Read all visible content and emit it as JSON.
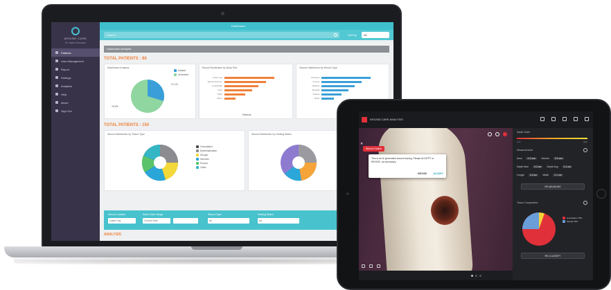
{
  "laptop": {
    "app_title": "Dashboard",
    "logo_text": "WOUND CARE",
    "logo_sub": "Dr. Name Surname",
    "nav_items": [
      {
        "label": "Patients"
      },
      {
        "label": "User Management"
      },
      {
        "label": "Report"
      },
      {
        "label": "Settings"
      },
      {
        "label": "Analytics"
      },
      {
        "label": "Help"
      },
      {
        "label": "About"
      },
      {
        "label": "Sign Out"
      }
    ],
    "search_placeholder": "Search",
    "sort_label": "Sort by",
    "sort_value": "All",
    "section_header": "Dashboard Analysis",
    "total_patients_1": "TOTAL PATIENTS : 80",
    "card1_title": "Distribution Analysis",
    "card1_legend": [
      "Healed",
      "Unhealed"
    ],
    "card1_pct_a": "21.1%",
    "card1_pct_b": "78.9%",
    "card2_title": "Wound Distribution by Body Part",
    "card2_bars": [
      {
        "label": "Lower Leg",
        "value": 0.9
      },
      {
        "label": "Sacrum/Coccyx",
        "value": 0.75
      },
      {
        "label": "Foot/Ankle",
        "value": 0.62
      },
      {
        "label": "Heel",
        "value": 0.5
      },
      {
        "label": "Thigh",
        "value": 0.38
      },
      {
        "label": "Other",
        "value": 0.2
      }
    ],
    "card2_axis": "Patients",
    "card3_title": "Wound Distribution by Wound Type",
    "card3_bars": [
      {
        "label": "Pressure",
        "value": 0.88
      },
      {
        "label": "Venous",
        "value": 0.72
      },
      {
        "label": "Diabetic",
        "value": 0.6
      },
      {
        "label": "Surgical",
        "value": 0.48
      },
      {
        "label": "Trauma",
        "value": 0.36
      },
      {
        "label": "Other",
        "value": 0.22
      }
    ],
    "total_patients_2": "TOTAL PATIENTS : 150",
    "card4_title": "Wound Distribution by Tissue Type",
    "card4_legend": [
      "Granulation",
      "Epithelialization",
      "Slough",
      "Necrotic",
      "Eschar",
      "Other"
    ],
    "card5_title": "Wound Distribution by Healing Status",
    "filters": [
      {
        "label": "Wound Location",
        "value": "Lower Leg"
      },
      {
        "label": "Select Date Range",
        "value": "Current Year"
      },
      {
        "label": "Wound Type",
        "value": "All"
      },
      {
        "label": "Healing Status",
        "value": "All"
      }
    ],
    "footer_title": "ANALYSIS"
  },
  "tablet": {
    "app_title": "WOUND CARE ANALYSIS",
    "segment_button": "Wound Outline",
    "popup_text": "This is an AI generated wound tracing. Please ACCEPT or REVISE, as necessary.",
    "popup_revise": "REVISE",
    "popup_accept": "ACCEPT",
    "panel_header_1": "Depth Scale",
    "grad_low": "Low",
    "grad_high": "High",
    "panel_header_2": "Measurements",
    "measurements": [
      {
        "k1": "Area",
        "v1": "4.3 cm²",
        "k2": "Volume",
        "v2": "0.9 cm³"
      },
      {
        "k1": "Depth Max",
        "v1": "0.2 cm",
        "k2": "Depth Avg",
        "v2": "0.1 cm"
      },
      {
        "k1": "Length",
        "v1": "2.3 cm",
        "k2": "Width",
        "v2": "2.1 cm"
      }
    ],
    "remeasure_btn": "RE-MEASURE",
    "panel_header_3": "Tissue Composition",
    "tissue_legend": [
      "Granulation 75%",
      "Slough 25%"
    ],
    "reclassify_btn": "RE-CLASSIFY"
  },
  "colors": {
    "accent_teal": "#3fbfcc",
    "accent_orange": "#f0813a",
    "sidebar": "#39334a",
    "alert_red": "#e0303a"
  }
}
